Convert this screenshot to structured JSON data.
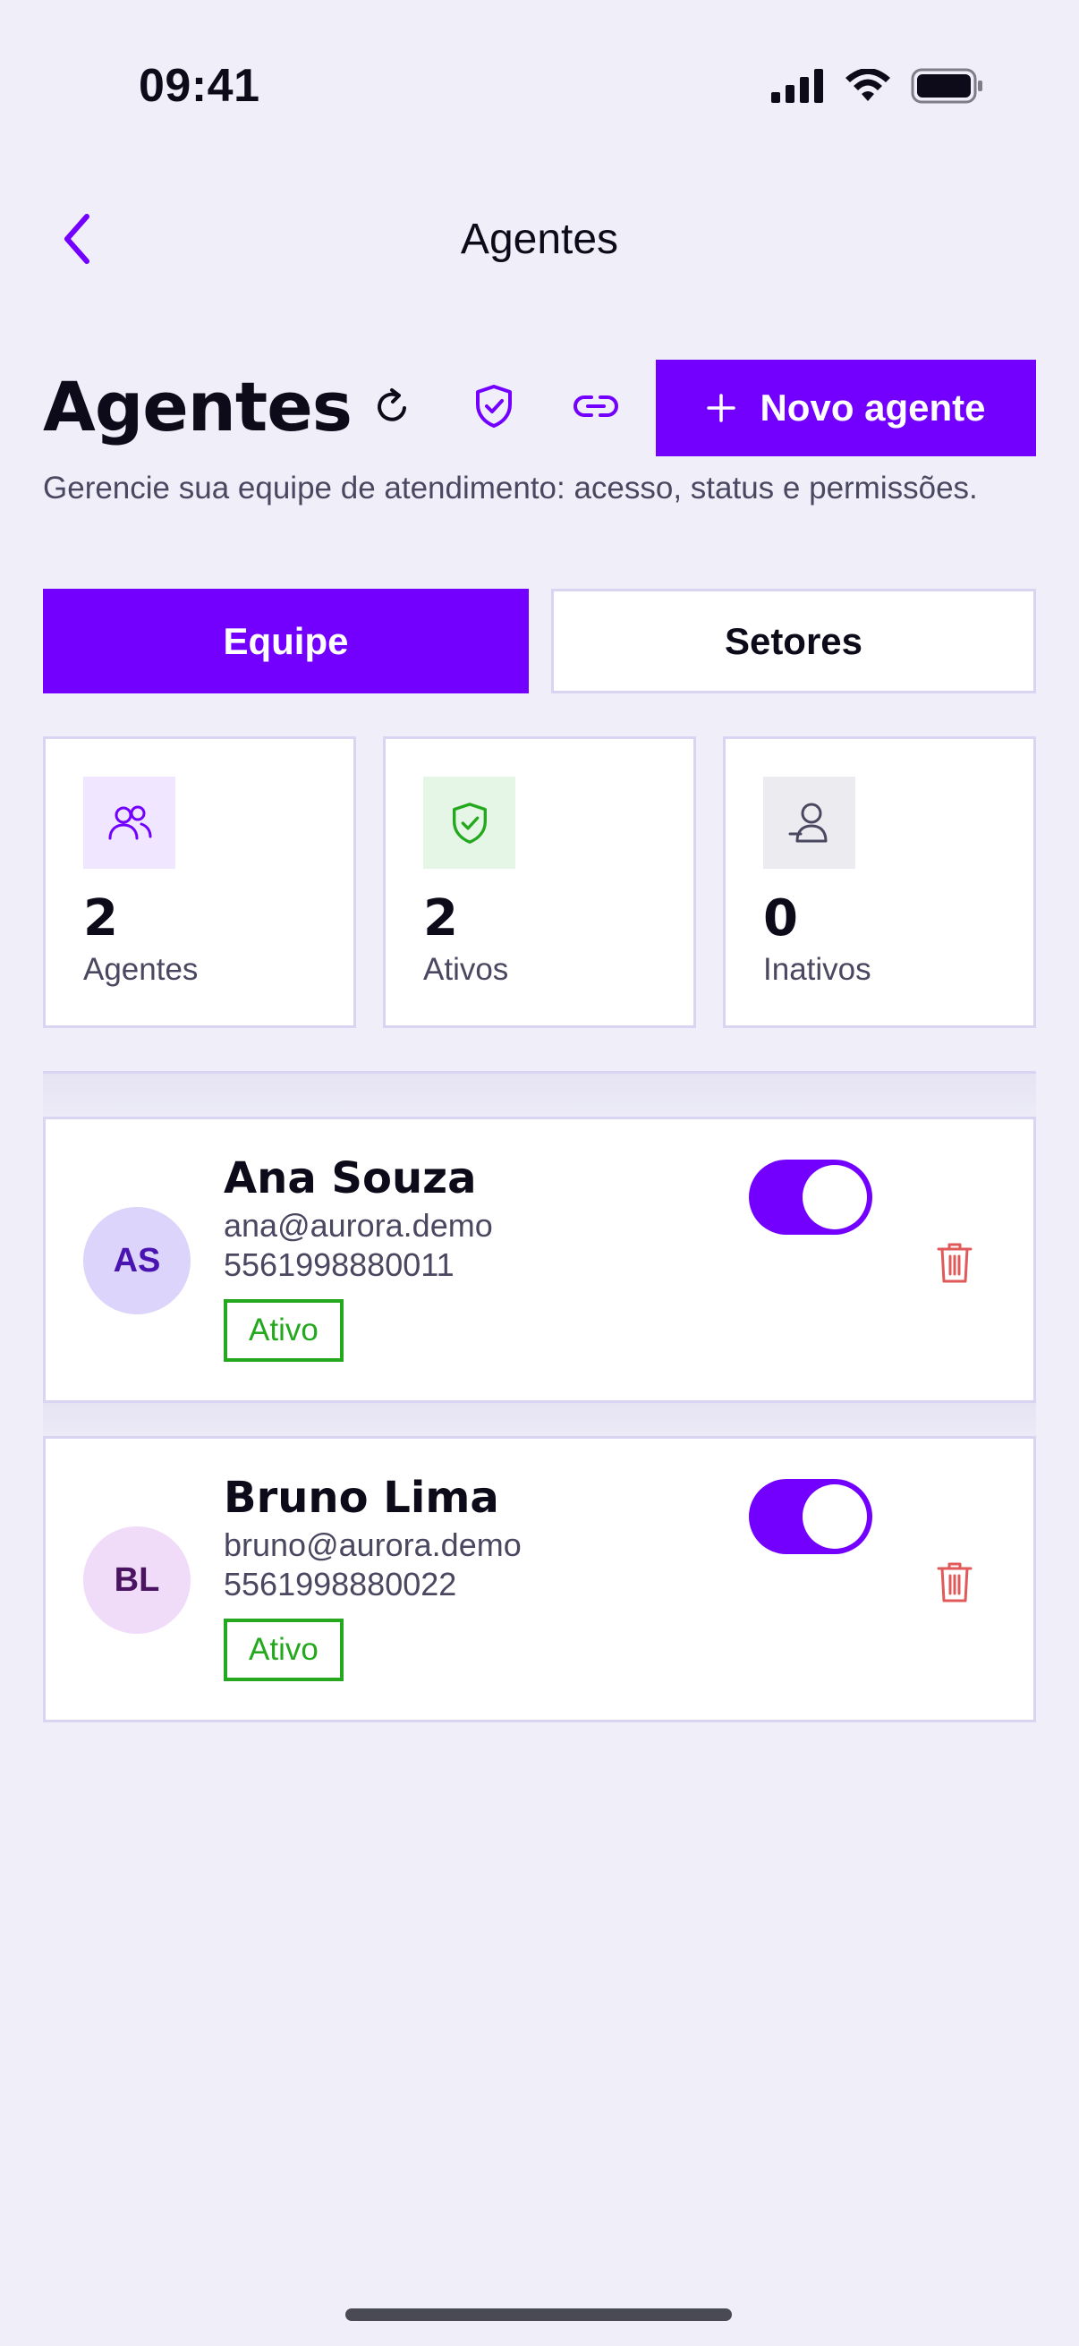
{
  "status_bar": {
    "time": "09:41"
  },
  "nav": {
    "title": "Agentes"
  },
  "header": {
    "title": "Agentes",
    "subtitle": "Gerencie sua equipe de atendimento: acesso, status e permissões.",
    "new_button": "Novo agente"
  },
  "tabs": [
    {
      "label": "Equipe",
      "active": true
    },
    {
      "label": "Setores",
      "active": false
    }
  ],
  "stats": [
    {
      "value": "2",
      "label": "Agentes",
      "icon": "users-icon",
      "bg": "#f0e6ff",
      "color": "#7300ff"
    },
    {
      "value": "2",
      "label": "Ativos",
      "icon": "shield-check-icon",
      "bg": "#e6f6e6",
      "color": "#23a81e"
    },
    {
      "value": "0",
      "label": "Inativos",
      "icon": "user-icon",
      "bg": "#ececf0",
      "color": "#4a4760"
    }
  ],
  "agents": [
    {
      "initials": "AS",
      "name": "Ana Souza",
      "email": "ana@aurora.demo",
      "phone": "5561998880011",
      "status": "Ativo",
      "enabled": true,
      "avatar_bg": "#dcd4fa",
      "avatar_color": "#4a14b0"
    },
    {
      "initials": "BL",
      "name": "Bruno Lima",
      "email": "bruno@aurora.demo",
      "phone": "5561998880022",
      "status": "Ativo",
      "enabled": true,
      "avatar_bg": "#f0dcf8",
      "avatar_color": "#4a1460"
    }
  ],
  "colors": {
    "accent": "#7300ff",
    "success": "#23a81e",
    "danger": "#e05a5a",
    "background": "#f0eff9"
  }
}
